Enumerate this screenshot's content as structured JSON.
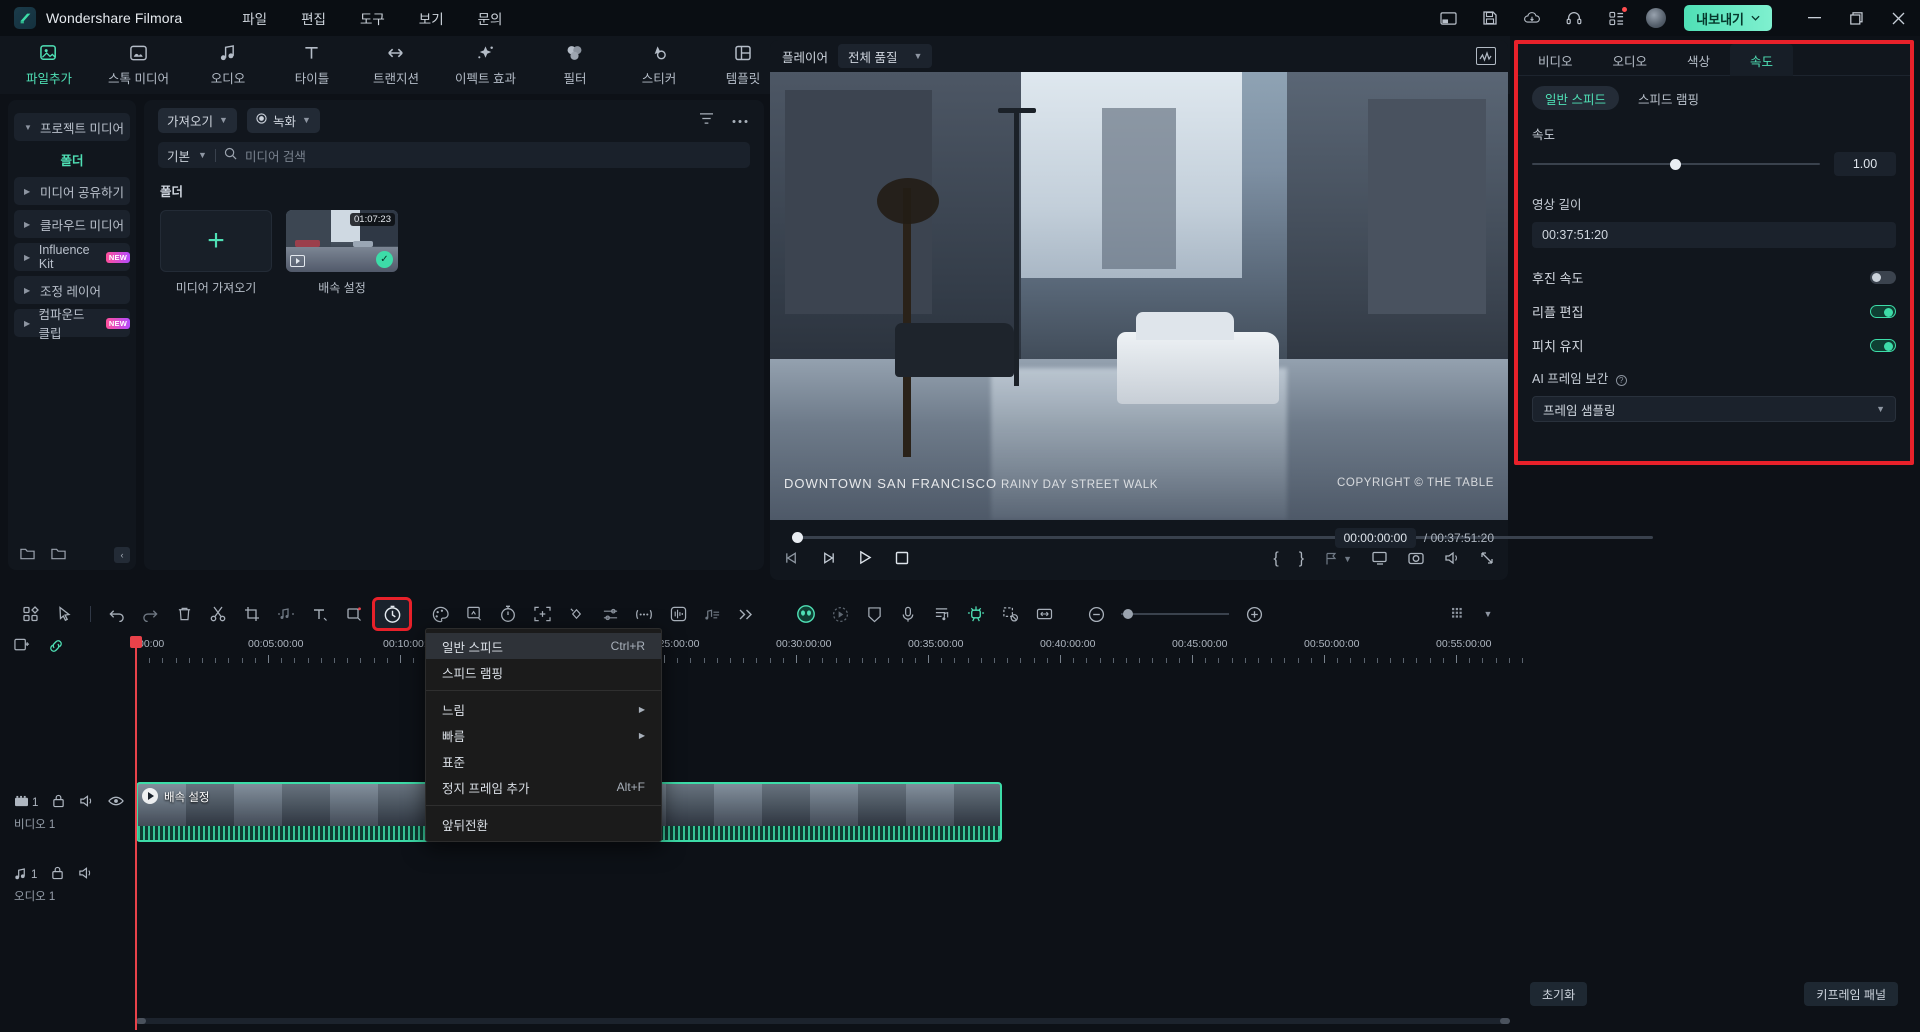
{
  "app": {
    "brand": "Wondershare Filmora",
    "menu": [
      "파일",
      "편집",
      "도구",
      "보기",
      "문의"
    ],
    "titlebar_icons": [
      "layout-icon",
      "save-icon",
      "cloud-upload-icon",
      "headset-icon",
      "apps-grid-icon"
    ],
    "export_label": "내보내기",
    "window_buttons": [
      "minimize-icon",
      "maximize-icon",
      "close-icon"
    ],
    "accent": "#4fe0b5",
    "highlight": "#e8212a"
  },
  "toptabs": [
    {
      "label": "파일추가",
      "icon": "add-file-icon",
      "active": true
    },
    {
      "label": "스톡 미디어",
      "icon": "stock-media-icon",
      "active": false
    },
    {
      "label": "오디오",
      "icon": "audio-note-icon",
      "active": false
    },
    {
      "label": "타이틀",
      "icon": "title-text-icon",
      "active": false
    },
    {
      "label": "트랜지션",
      "icon": "transition-icon",
      "active": false
    },
    {
      "label": "이펙트 효과",
      "icon": "effects-sparkle-icon",
      "active": false
    },
    {
      "label": "필터",
      "icon": "filter-circles-icon",
      "active": false
    },
    {
      "label": "스티커",
      "icon": "sticker-icon",
      "active": false
    },
    {
      "label": "템플릿",
      "icon": "template-grid-icon",
      "active": false
    }
  ],
  "sidebar": {
    "items": [
      {
        "label": "프로젝트 미디어",
        "expanded": true,
        "badge": null
      },
      {
        "label": "미디어 공유하기",
        "expanded": false,
        "badge": null
      },
      {
        "label": "클라우드 미디어",
        "expanded": false,
        "badge": null
      },
      {
        "label": "Influence Kit",
        "expanded": false,
        "badge": "NEW"
      },
      {
        "label": "조정 레이어",
        "expanded": false,
        "badge": null
      },
      {
        "label": "컴파운드 클립",
        "expanded": false,
        "badge": "NEW"
      }
    ],
    "sub_label": "폴더",
    "bottom_icons": [
      "new-folder-icon",
      "folder-icon"
    ],
    "collapse_icon": "chevron-left-icon"
  },
  "media": {
    "import_btn": "가져오기",
    "record_btn": "녹화",
    "sort_label": "기본",
    "search_placeholder": "미디어 검색",
    "search_value": "",
    "folder_heading": "폴더",
    "filter_icon": "filter-icon",
    "more_icon": "more-dots-icon",
    "cells": [
      {
        "type": "import",
        "label": "미디어 가져오기",
        "icon": "plus-icon"
      },
      {
        "type": "clip",
        "label": "배속 설정",
        "duration": "01:07:23",
        "selected": true
      }
    ]
  },
  "preview": {
    "player_label": "플레이어",
    "quality": "전체 품질",
    "scope_icon": "waveform-scope-icon",
    "overlay_title": "DOWNTOWN SAN FRANCISCO",
    "overlay_sub": "RAINY DAY STREET WALK",
    "overlay_right": "COPYRIGHT © THE TABLE",
    "current_time": "00:00:00:00",
    "total_time": "00:37:51:20",
    "separator": "/",
    "controls": [
      "prev-frame-icon",
      "next-frame-icon",
      "play-icon",
      "stop-icon"
    ],
    "right_controls": [
      "mark-in-icon",
      "mark-out-icon",
      "add-marker-icon",
      "snapshot-screen-icon",
      "camera-icon",
      "volume-icon",
      "fullscreen-icon"
    ],
    "mark_in": "{",
    "mark_out": "}"
  },
  "properties": {
    "tabs": [
      {
        "label": "비디오",
        "active": false
      },
      {
        "label": "오디오",
        "active": false
      },
      {
        "label": "색상",
        "active": false
      },
      {
        "label": "속도",
        "active": true
      }
    ],
    "segments": [
      {
        "label": "일반 스피드",
        "active": true
      },
      {
        "label": "스피드 램핑",
        "active": false
      }
    ],
    "speed_label": "속도",
    "speed_value": "1.00",
    "duration_label": "영상 길이",
    "duration_value": "00:37:51:20",
    "toggles": [
      {
        "label": "후진 속도",
        "on": false
      },
      {
        "label": "리플 편집",
        "on": true
      },
      {
        "label": "피치 유지",
        "on": true
      }
    ],
    "ai_label": "AI 프레임 보간",
    "ai_help_icon": "help-circle-icon",
    "ai_value": "프레임 샘플링",
    "reset_label": "초기화",
    "keyframe_label": "키프레임 패널"
  },
  "timeline": {
    "toolbar_left": [
      "layout-grid-icon",
      "select-pointer-icon",
      "undo-icon",
      "redo-icon",
      "delete-icon",
      "split-scissors-icon",
      "crop-icon",
      "audio-detach-icon",
      "text-icon",
      "mask-icon"
    ],
    "speed_tool_icon": "speed-clock-icon",
    "toolbar_mid": [
      "color-palette-icon",
      "green-screen-icon",
      "stopwatch-icon",
      "add-frame-icon",
      "keyframe-diamond-icon",
      "adjust-sliders-icon",
      "silence-detect-icon",
      "audio-wave-box-icon",
      "music-beat-icon",
      "more-chevrons-icon"
    ],
    "toolbar_right": [
      "ai-face-icon",
      "motion-tracking-icon",
      "shield-icon",
      "mic-icon",
      "subtitle-icon",
      "ai-tool-icon",
      "sticker-remove-icon",
      "fit-timeline-icon"
    ],
    "zoom_out_icon": "zoom-out-icon",
    "zoom_in_icon": "zoom-in-icon",
    "view_icon": "view-options-icon",
    "head_icons": [
      "add-track-icon",
      "link-icon"
    ],
    "ruler_labels": [
      "00:00",
      "00:05:00:00",
      "00:10:00:00",
      "00:25:00:00",
      "00:30:00:00",
      "00:35:00:00",
      "00:40:00:00",
      "00:45:00:00",
      "00:50:00:00",
      "00:55:00:00"
    ],
    "tracks": [
      {
        "name": "비디오 1",
        "number": "1",
        "type": "video",
        "icons": [
          "film-icon",
          "lock-icon",
          "mute-icon",
          "eye-icon"
        ]
      },
      {
        "name": "오디오 1",
        "number": "1",
        "type": "audio",
        "icons": [
          "music-icon",
          "lock-icon",
          "mute-icon"
        ]
      }
    ],
    "clip_title": "배속 설정"
  },
  "context_menu": {
    "items": [
      {
        "label": "일반 스피드",
        "shortcut": "Ctrl+R",
        "submenu": false,
        "highlighted": true
      },
      {
        "label": "스피드 램핑",
        "shortcut": "",
        "submenu": false,
        "highlighted": false
      },
      {
        "sep": true
      },
      {
        "label": "느림",
        "shortcut": "",
        "submenu": true,
        "highlighted": false
      },
      {
        "label": "빠름",
        "shortcut": "",
        "submenu": true,
        "highlighted": false
      },
      {
        "label": "표준",
        "shortcut": "",
        "submenu": false,
        "highlighted": false
      },
      {
        "label": "정지 프레임 추가",
        "shortcut": "Alt+F",
        "submenu": false,
        "highlighted": false
      },
      {
        "sep": true
      },
      {
        "label": "앞뒤전환",
        "shortcut": "",
        "submenu": false,
        "highlighted": false
      }
    ]
  }
}
